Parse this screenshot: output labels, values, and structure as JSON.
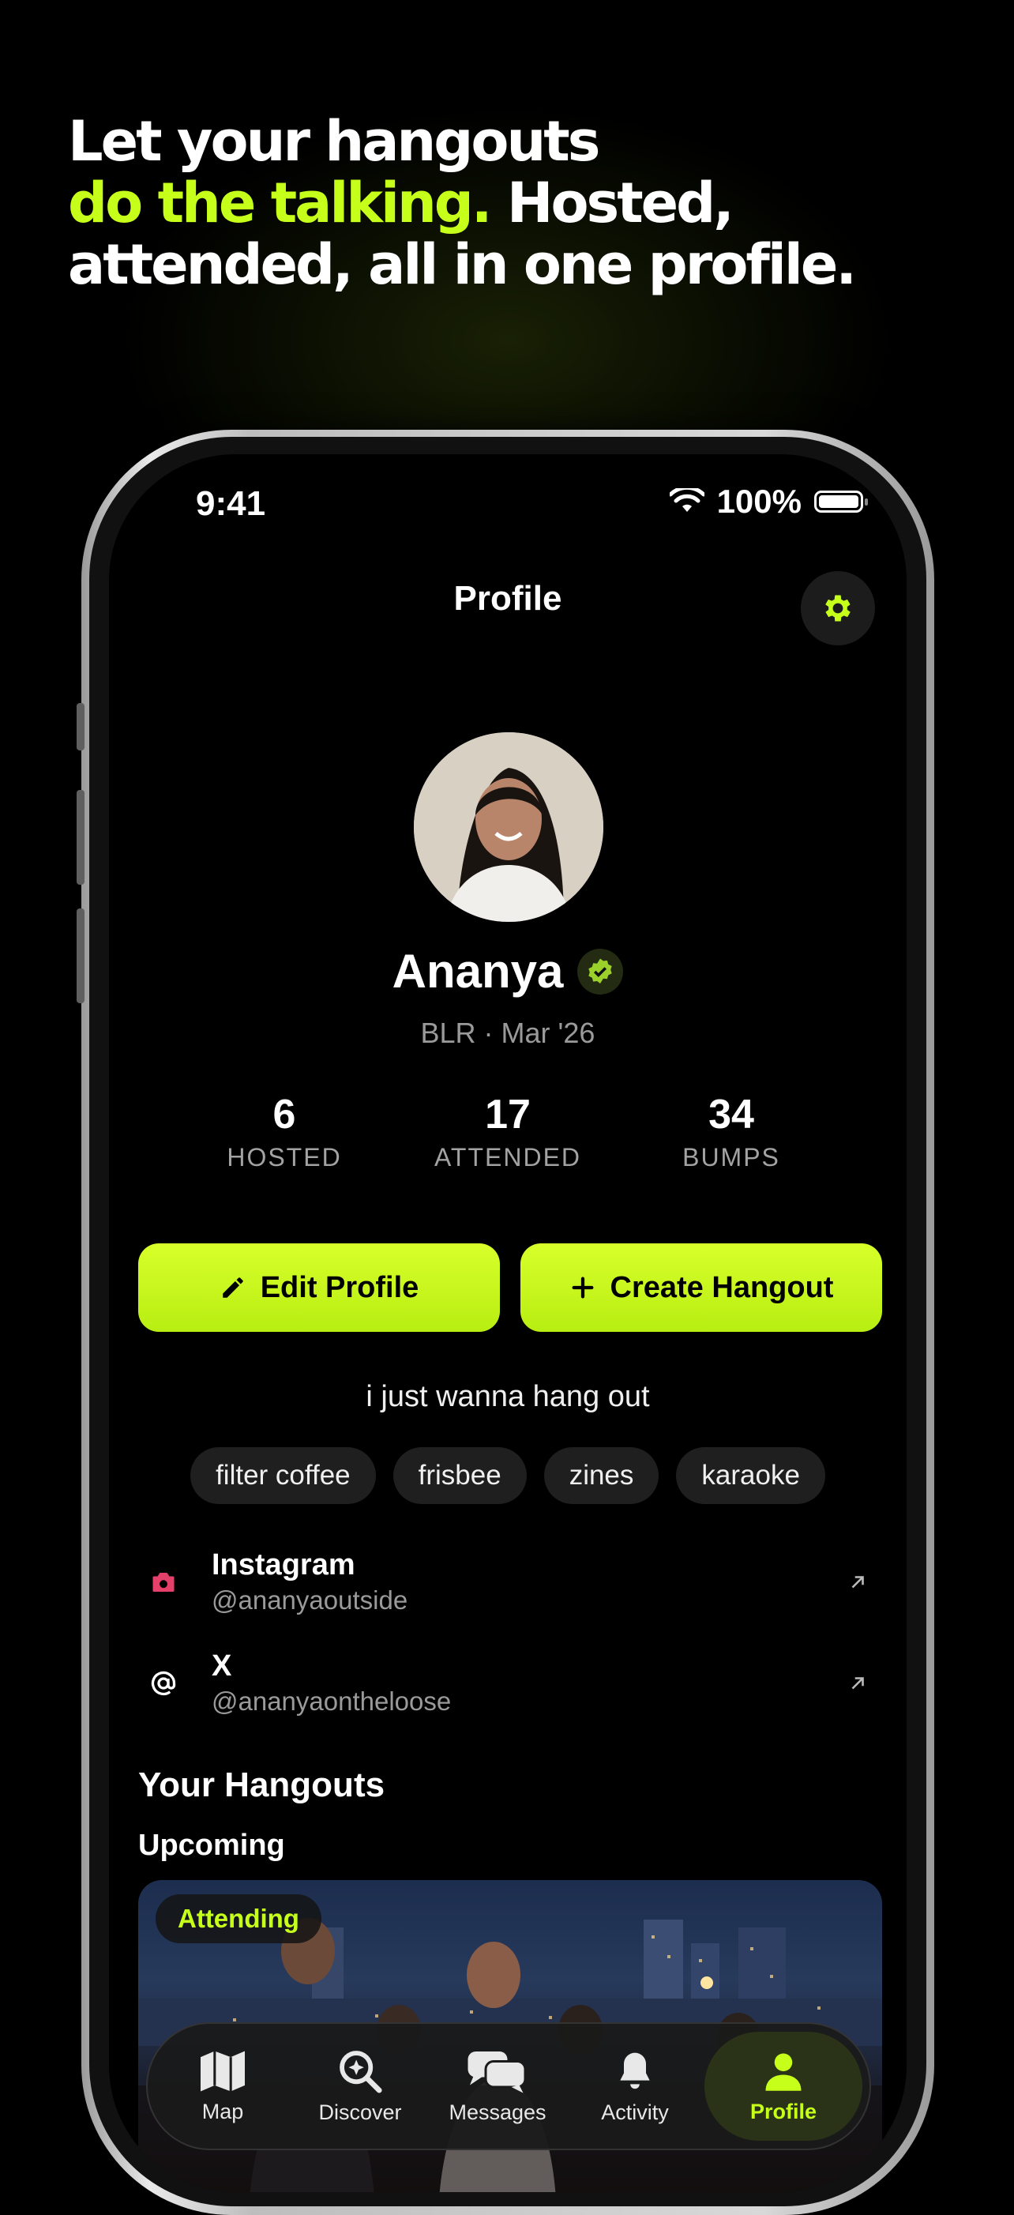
{
  "marketing": {
    "line1": "Let your hangouts",
    "highlight": "do the talking.",
    "line2_rest": " Hosted,",
    "line3": "attended, all in one profile."
  },
  "status_bar": {
    "time": "9:41",
    "battery": "100%"
  },
  "header": {
    "title": "Profile",
    "settings_icon": "gear-icon"
  },
  "profile": {
    "name": "Ananya",
    "verified_icon": "verified-check-icon",
    "meta": "BLR · Mar '26",
    "stats": [
      {
        "value": "6",
        "label": "HOSTED"
      },
      {
        "value": "17",
        "label": "ATTENDED"
      },
      {
        "value": "34",
        "label": "BUMPS"
      }
    ],
    "edit_label": "Edit Profile",
    "create_label": "Create Hangout",
    "bio": "i just wanna hang out",
    "interests": [
      "filter coffee",
      "frisbee",
      "zines",
      "karaoke"
    ],
    "socials": [
      {
        "name": "Instagram",
        "handle": "@ananyaoutside",
        "icon": "camera-icon"
      },
      {
        "name": "X",
        "handle": "@ananyaontheloose",
        "icon": "at-icon"
      }
    ]
  },
  "hangouts": {
    "title": "Your Hangouts",
    "subtitle": "Upcoming",
    "card": {
      "badge": "Attending"
    }
  },
  "tabbar": {
    "tabs": [
      {
        "label": "Map",
        "icon": "map-icon"
      },
      {
        "label": "Discover",
        "icon": "discover-search-icon"
      },
      {
        "label": "Messages",
        "icon": "messages-icon"
      },
      {
        "label": "Activity",
        "icon": "bell-icon"
      },
      {
        "label": "Profile",
        "icon": "person-icon"
      }
    ],
    "active": "Profile"
  },
  "colors": {
    "accent": "#c6ff1a",
    "background": "#000000",
    "chip": "#1f1f1f",
    "instagram": "#e5406a"
  }
}
